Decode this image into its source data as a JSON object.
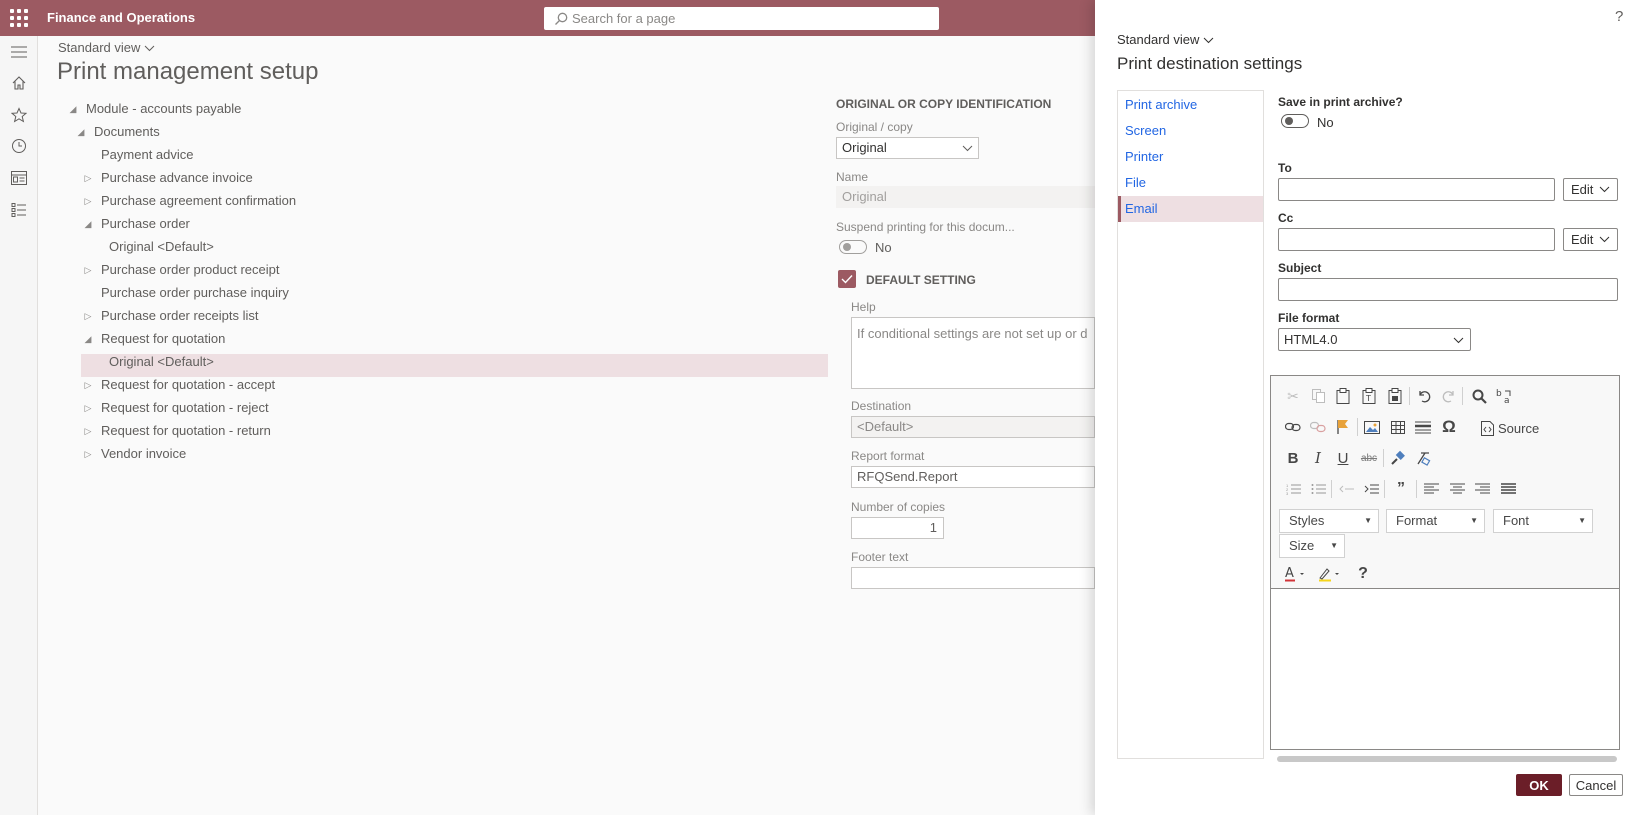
{
  "header": {
    "app_title": "Finance and Operations",
    "search_placeholder": "Search for a page"
  },
  "main": {
    "standard_view": "Standard view",
    "page_title": "Print management setup",
    "tree": [
      {
        "label": "Module - accounts payable",
        "toggle": "expanded"
      },
      {
        "label": "Documents",
        "toggle": "expanded"
      },
      {
        "label": "Payment advice",
        "toggle": "none"
      },
      {
        "label": "Purchase advance invoice",
        "toggle": "collapsed"
      },
      {
        "label": "Purchase agreement confirmation",
        "toggle": "collapsed"
      },
      {
        "label": "Purchase order",
        "toggle": "expanded"
      },
      {
        "label": "Original <Default>",
        "toggle": "none"
      },
      {
        "label": "Purchase order product receipt",
        "toggle": "collapsed"
      },
      {
        "label": "Purchase order purchase inquiry",
        "toggle": "none"
      },
      {
        "label": "Purchase order receipts list",
        "toggle": "collapsed"
      },
      {
        "label": "Request for quotation",
        "toggle": "expanded"
      },
      {
        "label": "Original <Default>",
        "toggle": "none"
      },
      {
        "label": "Request for quotation - accept",
        "toggle": "collapsed"
      },
      {
        "label": "Request for quotation - reject",
        "toggle": "collapsed"
      },
      {
        "label": "Request for quotation - return",
        "toggle": "collapsed"
      },
      {
        "label": "Vendor invoice",
        "toggle": "collapsed"
      }
    ],
    "details": {
      "section_heading": "ORIGINAL OR COPY IDENTIFICATION",
      "original_copy_label": "Original / copy",
      "original_copy_value": "Original",
      "name_label": "Name",
      "name_value": "Original",
      "suspend_label": "Suspend printing for this docum...",
      "suspend_value": "No",
      "default_setting_label": "DEFAULT SETTING",
      "help_label": "Help",
      "help_value": "If conditional settings are not set up or d",
      "destination_label": "Destination",
      "destination_value": "<Default>",
      "report_format_label": "Report format",
      "report_format_value": "RFQSend.Report",
      "copies_label": "Number of copies",
      "copies_value": "1",
      "footer_label": "Footer text"
    }
  },
  "panel": {
    "help": "?",
    "standard_view": "Standard view",
    "title": "Print destination settings",
    "nav": [
      "Print archive",
      "Screen",
      "Printer",
      "File",
      "Email"
    ],
    "active_nav": "Email",
    "save_archive_label": "Save in print archive?",
    "save_archive_value": "No",
    "to_label": "To",
    "cc_label": "Cc",
    "edit_label": "Edit",
    "subject_label": "Subject",
    "file_format_label": "File format",
    "file_format_value": "HTML4.0",
    "editor": {
      "source_label": "Source",
      "styles": "Styles",
      "format": "Format",
      "font": "Font",
      "size": "Size",
      "omega": "Ω",
      "help": "?"
    },
    "ok": "OK",
    "cancel": "Cancel"
  }
}
